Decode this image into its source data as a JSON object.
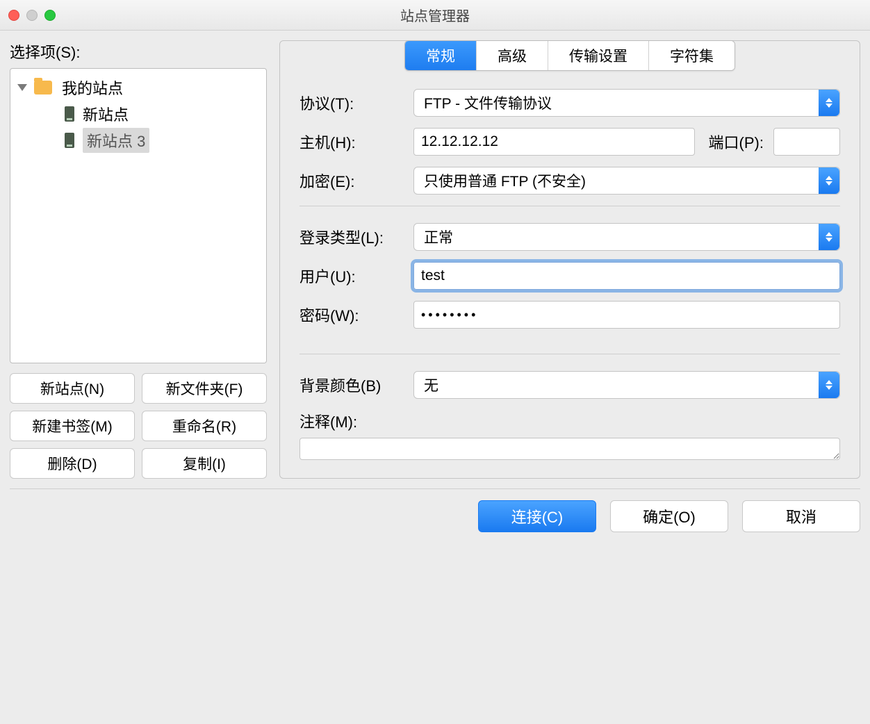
{
  "window": {
    "title": "站点管理器"
  },
  "left": {
    "label": "选择项(S):",
    "tree": {
      "root": "我的站点",
      "items": [
        {
          "label": "新站点"
        },
        {
          "label": "新站点 3",
          "selected": true
        }
      ]
    },
    "buttons": {
      "new_site": "新站点(N)",
      "new_folder": "新文件夹(F)",
      "new_bookmark": "新建书签(M)",
      "rename": "重命名(R)",
      "delete": "删除(D)",
      "copy": "复制(I)"
    }
  },
  "tabs": {
    "general": "常规",
    "advanced": "高级",
    "transfer": "传输设置",
    "charset": "字符集"
  },
  "form": {
    "protocol_label": "协议(T):",
    "protocol_value": "FTP - 文件传输协议",
    "host_label": "主机(H):",
    "host_value": "12.12.12.12",
    "port_label": "端口(P):",
    "port_value": "",
    "encryption_label": "加密(E):",
    "encryption_value": "只使用普通 FTP (不安全)",
    "logon_label": "登录类型(L):",
    "logon_value": "正常",
    "user_label": "用户(U):",
    "user_value": "test",
    "password_label": "密码(W):",
    "password_value": "••••••••",
    "bgcolor_label": "背景颜色(B)",
    "bgcolor_value": "无",
    "comment_label": "注释(M):",
    "comment_value": ""
  },
  "footer": {
    "connect": "连接(C)",
    "ok": "确定(O)",
    "cancel": "取消"
  }
}
